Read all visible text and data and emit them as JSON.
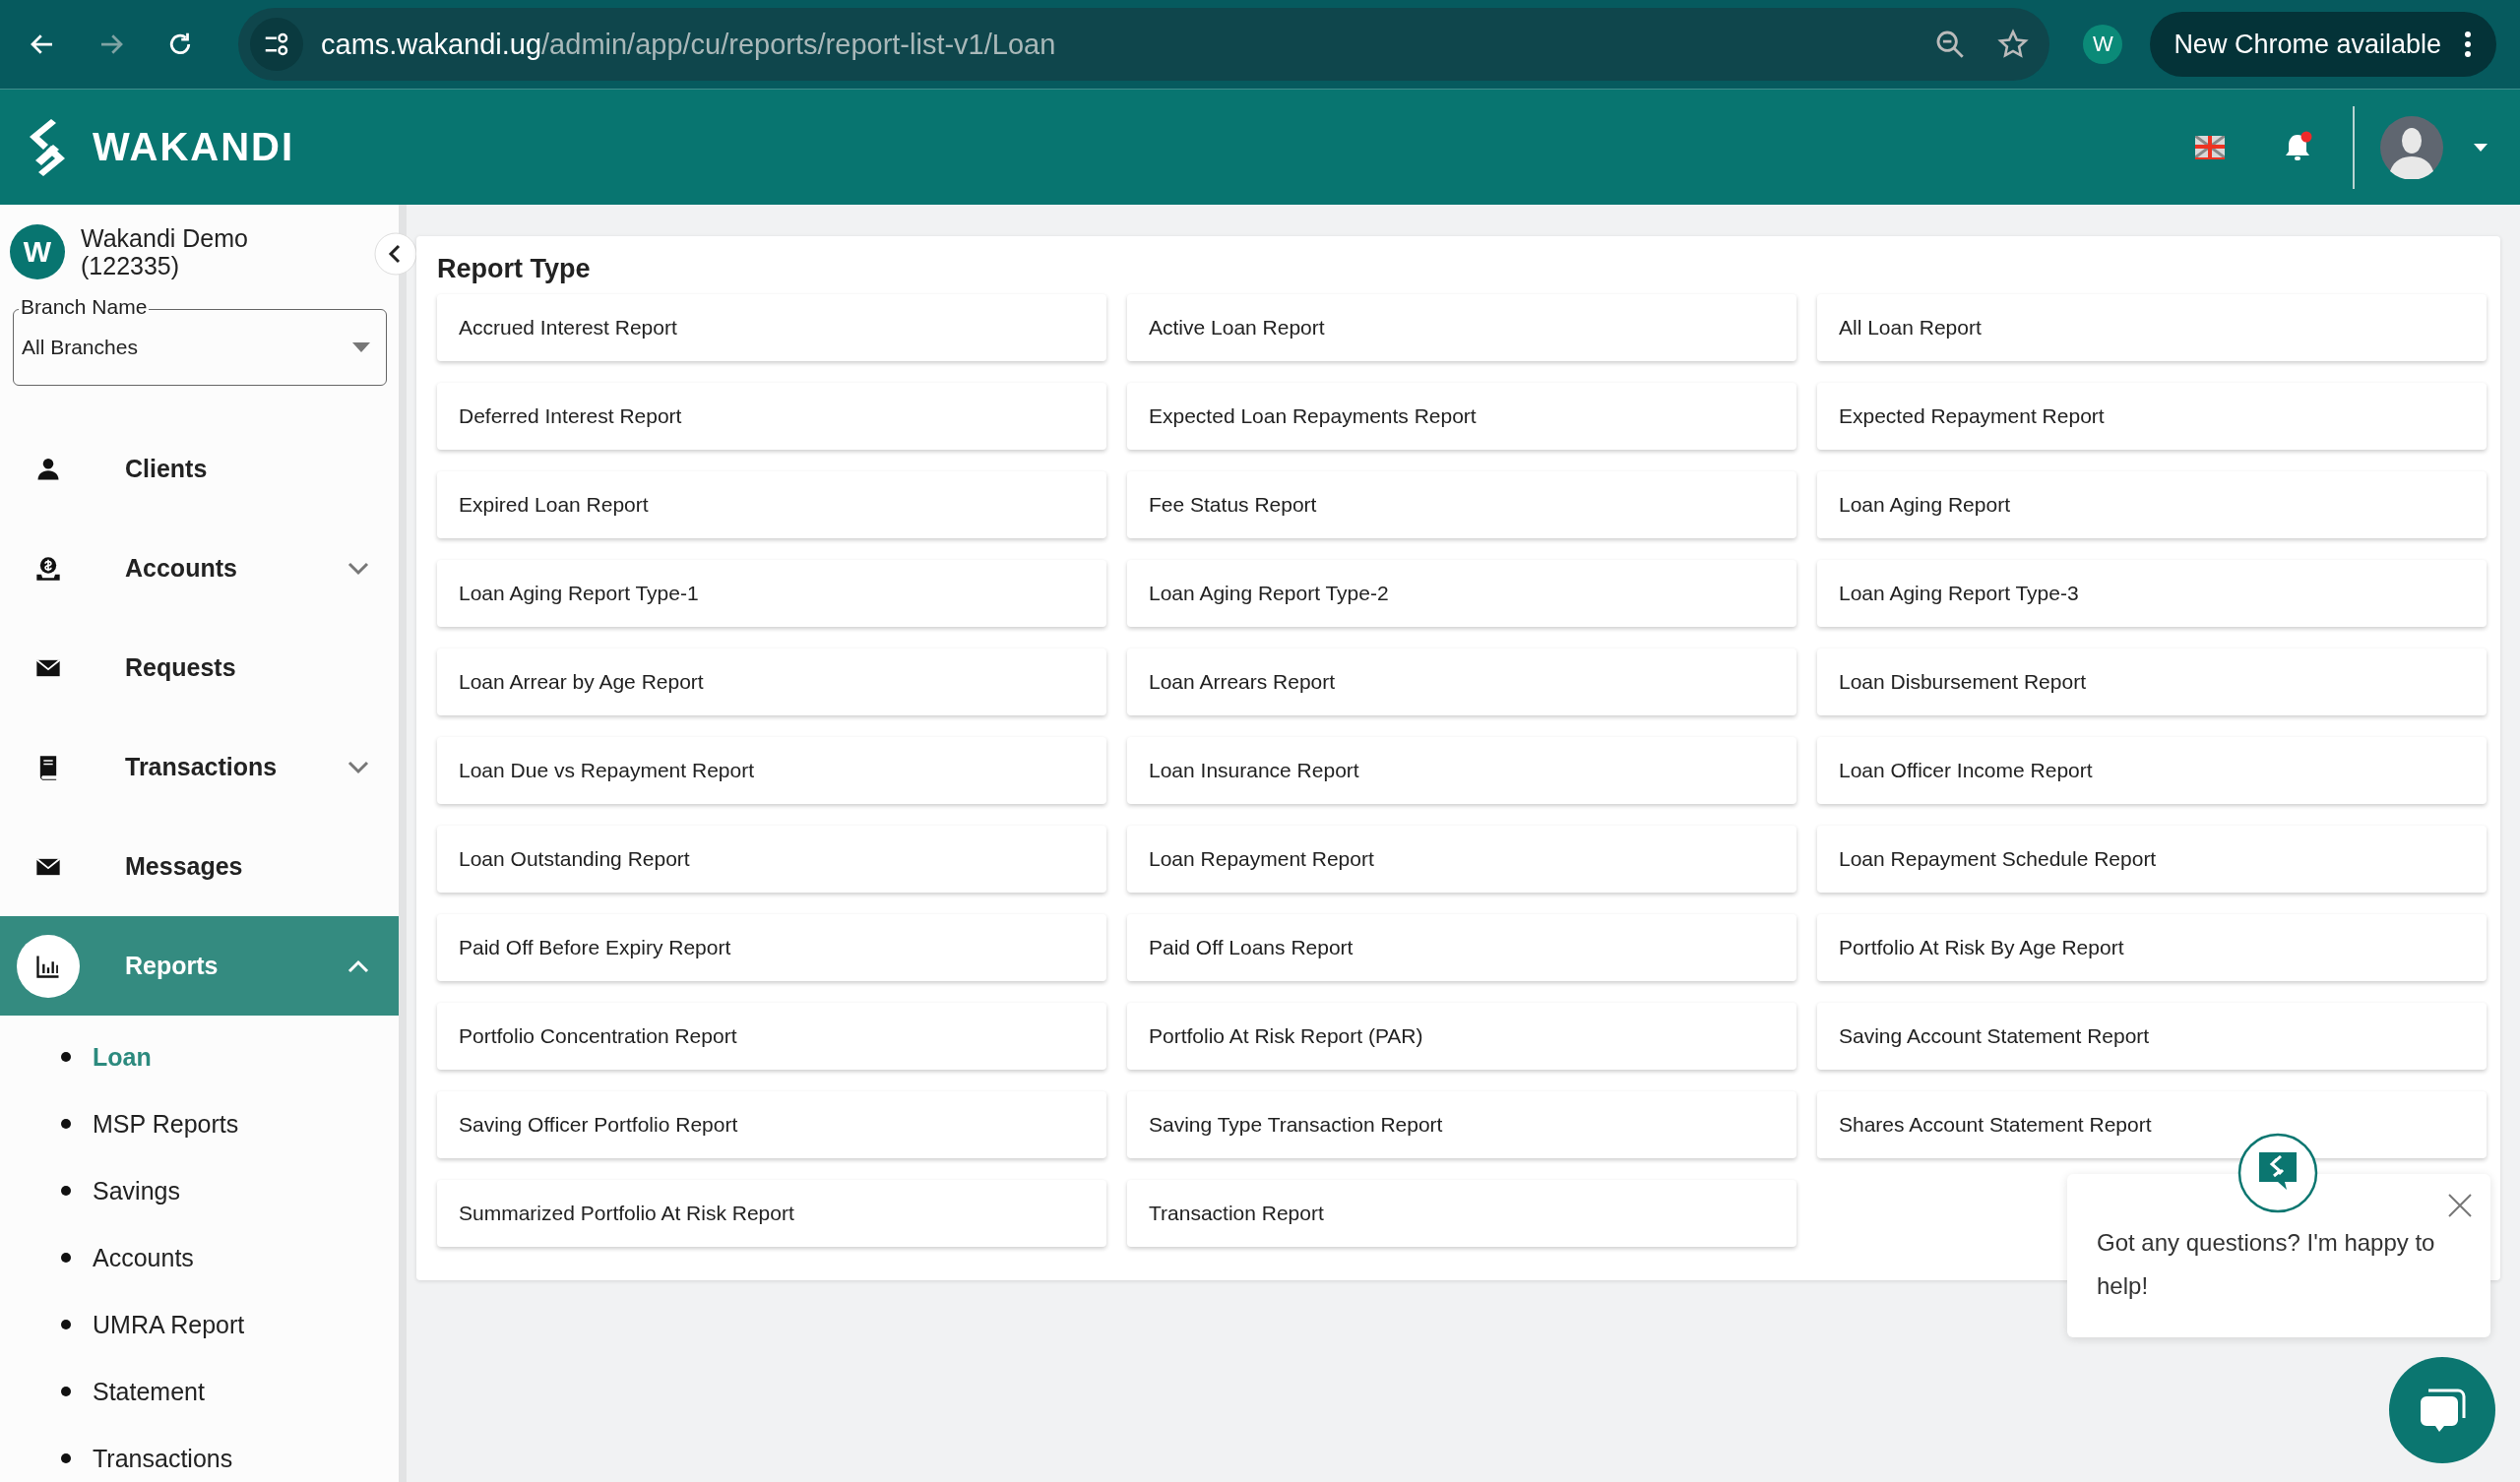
{
  "browser": {
    "url_host": "cams.wakandi.ug",
    "url_path": "/admin/app/cu/reports/report-list-v1/Loan",
    "profile_initial": "W",
    "update_label": "New Chrome available"
  },
  "header": {
    "brand": "WAKANDI",
    "has_unread_notifications": true
  },
  "sidebar": {
    "org_initial": "W",
    "org_name": "Wakandi Demo",
    "org_id": "(122335)",
    "branch_field": {
      "label": "Branch Name",
      "value": "All Branches"
    },
    "nav": [
      {
        "label": "Clients",
        "selected": false
      },
      {
        "label": "Accounts",
        "selected": false,
        "expanded": false
      },
      {
        "label": "Requests",
        "selected": false
      },
      {
        "label": "Transactions",
        "selected": false,
        "expanded": false
      },
      {
        "label": "Messages",
        "selected": false
      },
      {
        "label": "Reports",
        "selected": true,
        "expanded": true,
        "children": [
          {
            "label": "Loan",
            "selected": true
          },
          {
            "label": "MSP Reports",
            "selected": false
          },
          {
            "label": "Savings",
            "selected": false
          },
          {
            "label": "Accounts",
            "selected": false
          },
          {
            "label": "UMRA Report",
            "selected": false
          },
          {
            "label": "Statement",
            "selected": false
          },
          {
            "label": "Transactions",
            "selected": false
          }
        ]
      }
    ]
  },
  "report_type": {
    "title": "Report Type",
    "reports": [
      "Accrued Interest Report",
      "Active Loan Report",
      "All Loan Report",
      "Deferred Interest Report",
      "Expected Loan Repayments Report",
      "Expected Repayment Report",
      "Expired Loan Report",
      "Fee Status Report",
      "Loan Aging Report",
      "Loan Aging Report Type-1",
      "Loan Aging Report Type-2",
      "Loan Aging Report Type-3",
      "Loan Arrear by Age Report",
      "Loan Arrears Report",
      "Loan Disbursement Report",
      "Loan Due vs Repayment Report",
      "Loan Insurance Report",
      "Loan Officer Income Report",
      "Loan Outstanding Report",
      "Loan Repayment Report",
      "Loan Repayment Schedule Report",
      "Paid Off Before Expiry Report",
      "Paid Off Loans Report",
      "Portfolio At Risk By Age Report",
      "Portfolio Concentration Report",
      "Portfolio At Risk Report (PAR)",
      "Saving Account Statement Report",
      "Saving Officer Portfolio Report",
      "Saving Type Transaction Report",
      "Shares Account Statement Report",
      "Summarized Portfolio At Risk Report",
      "Transaction Report"
    ]
  },
  "chat": {
    "message": "Got any questions? I'm happy to help!"
  }
}
